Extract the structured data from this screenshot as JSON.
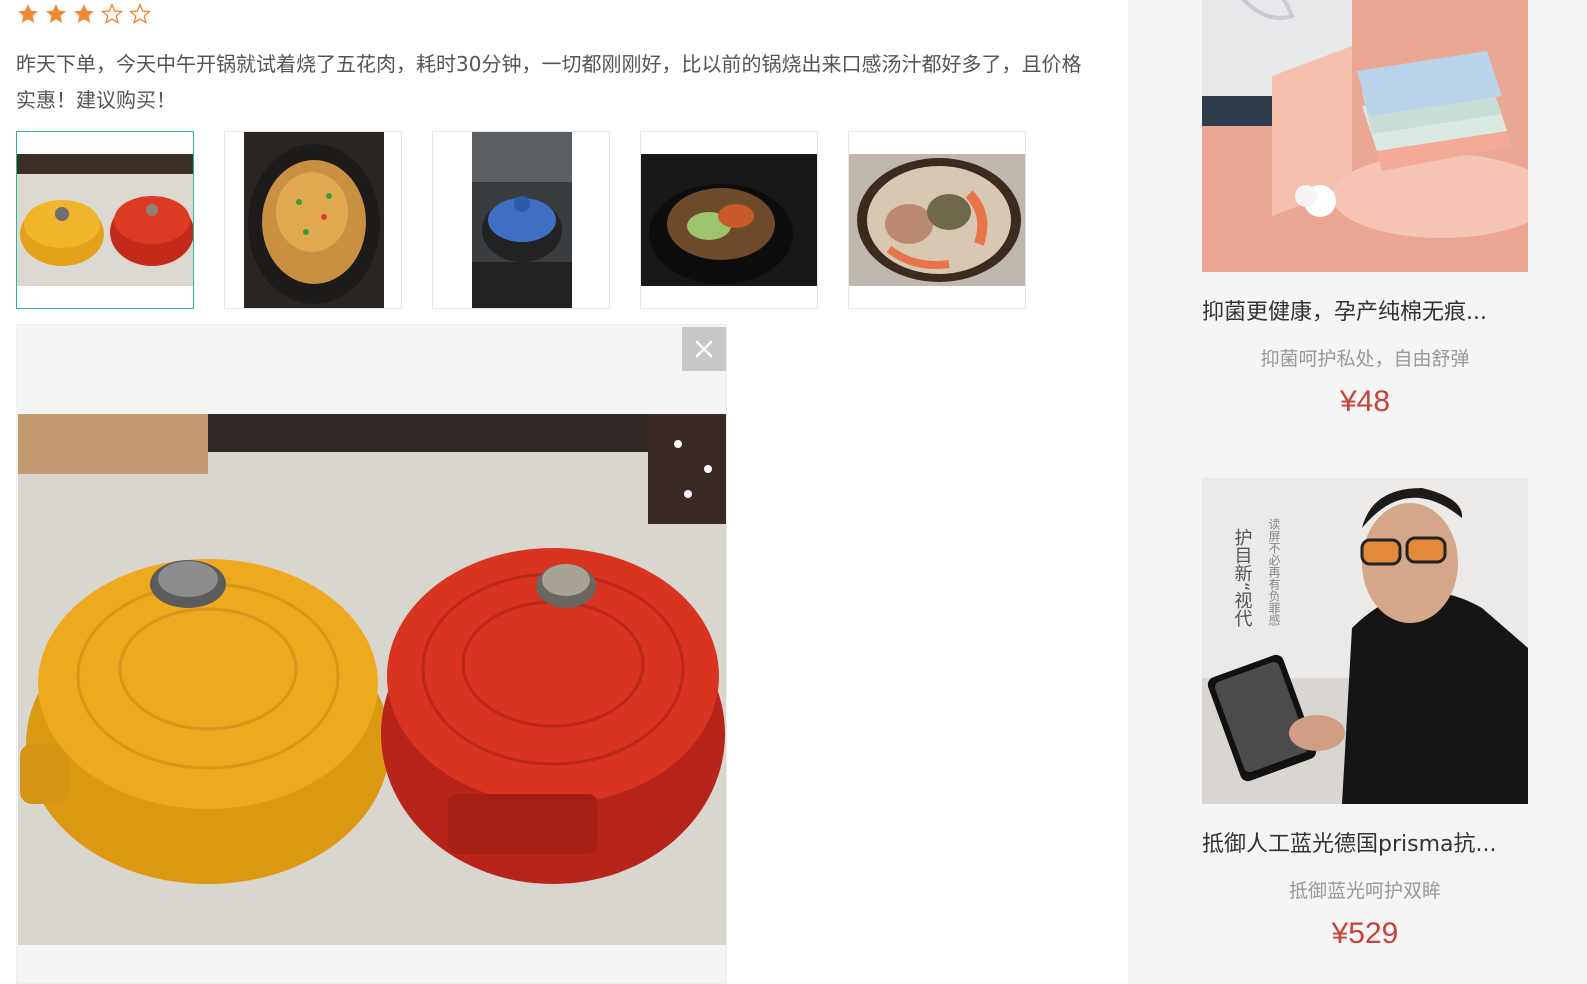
{
  "review": {
    "rating": 3,
    "rating_max": 5,
    "text": "昨天下单，今天中午开锅就试着烧了五花肉，耗时30分钟，一切都刚刚好，比以前的锅烧出来口感汤汁都好多了，且价格实惠！建议购买！",
    "thumbnails": [
      {
        "name": "yellow-and-red-cast-iron-pots"
      },
      {
        "name": "braised-dish-in-pot"
      },
      {
        "name": "blue-pot-on-stove"
      },
      {
        "name": "clay-pot-stew"
      },
      {
        "name": "noodle-soup-with-shrimp"
      }
    ],
    "active_thumbnail": 0
  },
  "colors": {
    "star": "#f08a32",
    "active_border": "#27b894",
    "price": "#c8413b"
  },
  "products": [
    {
      "name": "抑菌更健康，孕产纯棉无痕...",
      "desc": "抑菌呵护私处，自由舒弹",
      "price": "¥48"
    },
    {
      "name": "抵御人工蓝光德国prisma抗...",
      "desc": "抵御蓝光呵护双眸",
      "price": "¥529",
      "image_text": {
        "heading": "护目新“视代",
        "sub": "读屏不必再有负罪感"
      }
    }
  ]
}
